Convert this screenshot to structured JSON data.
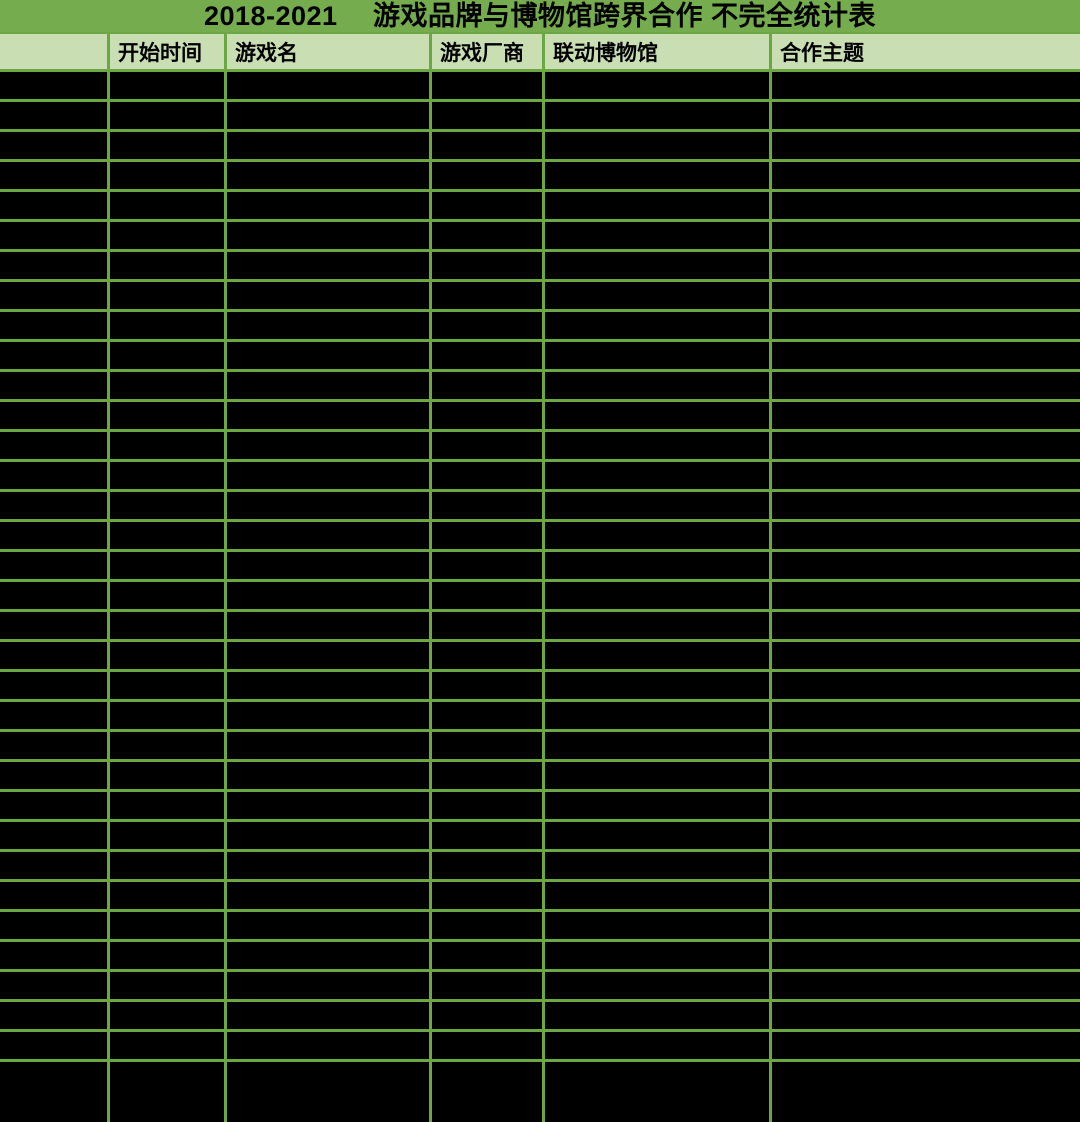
{
  "table": {
    "title": "2018-2021　 游戏品牌与博物馆跨界合作 不完全统计表",
    "columns": [
      {
        "label": ""
      },
      {
        "label": "开始时间"
      },
      {
        "label": "游戏名"
      },
      {
        "label": "游戏厂商"
      },
      {
        "label": "联动博物馆"
      },
      {
        "label": "合作主题"
      }
    ],
    "body_row_count": 34,
    "cells_blacked_out": true
  },
  "chart_data": {
    "type": "table",
    "title": "2018-2021　游戏品牌与博物馆跨界合作 不完全统计表",
    "columns": [
      "",
      "开始时间",
      "游戏名",
      "游戏厂商",
      "联动博物馆",
      "合作主题"
    ],
    "rows": [],
    "row_count": 34,
    "cells_blacked_out": true,
    "grid": true,
    "legend_position": "none"
  },
  "colors": {
    "title_bg": "#74AC4E",
    "header_bg": "#C9DEB2",
    "grid": "#6BA843",
    "cell_bg": "#000000",
    "text": "#000000"
  }
}
